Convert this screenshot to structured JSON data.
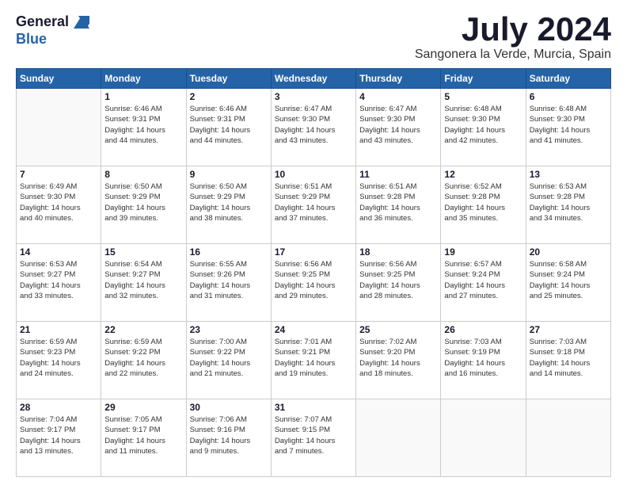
{
  "header": {
    "logo_line1": "General",
    "logo_line2": "Blue",
    "month": "July 2024",
    "location": "Sangonera la Verde, Murcia, Spain"
  },
  "days_of_week": [
    "Sunday",
    "Monday",
    "Tuesday",
    "Wednesday",
    "Thursday",
    "Friday",
    "Saturday"
  ],
  "weeks": [
    [
      {
        "day": "",
        "info": ""
      },
      {
        "day": "1",
        "info": "Sunrise: 6:46 AM\nSunset: 9:31 PM\nDaylight: 14 hours\nand 44 minutes."
      },
      {
        "day": "2",
        "info": "Sunrise: 6:46 AM\nSunset: 9:31 PM\nDaylight: 14 hours\nand 44 minutes."
      },
      {
        "day": "3",
        "info": "Sunrise: 6:47 AM\nSunset: 9:30 PM\nDaylight: 14 hours\nand 43 minutes."
      },
      {
        "day": "4",
        "info": "Sunrise: 6:47 AM\nSunset: 9:30 PM\nDaylight: 14 hours\nand 43 minutes."
      },
      {
        "day": "5",
        "info": "Sunrise: 6:48 AM\nSunset: 9:30 PM\nDaylight: 14 hours\nand 42 minutes."
      },
      {
        "day": "6",
        "info": "Sunrise: 6:48 AM\nSunset: 9:30 PM\nDaylight: 14 hours\nand 41 minutes."
      }
    ],
    [
      {
        "day": "7",
        "info": "Sunrise: 6:49 AM\nSunset: 9:30 PM\nDaylight: 14 hours\nand 40 minutes."
      },
      {
        "day": "8",
        "info": "Sunrise: 6:50 AM\nSunset: 9:29 PM\nDaylight: 14 hours\nand 39 minutes."
      },
      {
        "day": "9",
        "info": "Sunrise: 6:50 AM\nSunset: 9:29 PM\nDaylight: 14 hours\nand 38 minutes."
      },
      {
        "day": "10",
        "info": "Sunrise: 6:51 AM\nSunset: 9:29 PM\nDaylight: 14 hours\nand 37 minutes."
      },
      {
        "day": "11",
        "info": "Sunrise: 6:51 AM\nSunset: 9:28 PM\nDaylight: 14 hours\nand 36 minutes."
      },
      {
        "day": "12",
        "info": "Sunrise: 6:52 AM\nSunset: 9:28 PM\nDaylight: 14 hours\nand 35 minutes."
      },
      {
        "day": "13",
        "info": "Sunrise: 6:53 AM\nSunset: 9:28 PM\nDaylight: 14 hours\nand 34 minutes."
      }
    ],
    [
      {
        "day": "14",
        "info": "Sunrise: 6:53 AM\nSunset: 9:27 PM\nDaylight: 14 hours\nand 33 minutes."
      },
      {
        "day": "15",
        "info": "Sunrise: 6:54 AM\nSunset: 9:27 PM\nDaylight: 14 hours\nand 32 minutes."
      },
      {
        "day": "16",
        "info": "Sunrise: 6:55 AM\nSunset: 9:26 PM\nDaylight: 14 hours\nand 31 minutes."
      },
      {
        "day": "17",
        "info": "Sunrise: 6:56 AM\nSunset: 9:25 PM\nDaylight: 14 hours\nand 29 minutes."
      },
      {
        "day": "18",
        "info": "Sunrise: 6:56 AM\nSunset: 9:25 PM\nDaylight: 14 hours\nand 28 minutes."
      },
      {
        "day": "19",
        "info": "Sunrise: 6:57 AM\nSunset: 9:24 PM\nDaylight: 14 hours\nand 27 minutes."
      },
      {
        "day": "20",
        "info": "Sunrise: 6:58 AM\nSunset: 9:24 PM\nDaylight: 14 hours\nand 25 minutes."
      }
    ],
    [
      {
        "day": "21",
        "info": "Sunrise: 6:59 AM\nSunset: 9:23 PM\nDaylight: 14 hours\nand 24 minutes."
      },
      {
        "day": "22",
        "info": "Sunrise: 6:59 AM\nSunset: 9:22 PM\nDaylight: 14 hours\nand 22 minutes."
      },
      {
        "day": "23",
        "info": "Sunrise: 7:00 AM\nSunset: 9:22 PM\nDaylight: 14 hours\nand 21 minutes."
      },
      {
        "day": "24",
        "info": "Sunrise: 7:01 AM\nSunset: 9:21 PM\nDaylight: 14 hours\nand 19 minutes."
      },
      {
        "day": "25",
        "info": "Sunrise: 7:02 AM\nSunset: 9:20 PM\nDaylight: 14 hours\nand 18 minutes."
      },
      {
        "day": "26",
        "info": "Sunrise: 7:03 AM\nSunset: 9:19 PM\nDaylight: 14 hours\nand 16 minutes."
      },
      {
        "day": "27",
        "info": "Sunrise: 7:03 AM\nSunset: 9:18 PM\nDaylight: 14 hours\nand 14 minutes."
      }
    ],
    [
      {
        "day": "28",
        "info": "Sunrise: 7:04 AM\nSunset: 9:17 PM\nDaylight: 14 hours\nand 13 minutes."
      },
      {
        "day": "29",
        "info": "Sunrise: 7:05 AM\nSunset: 9:17 PM\nDaylight: 14 hours\nand 11 minutes."
      },
      {
        "day": "30",
        "info": "Sunrise: 7:06 AM\nSunset: 9:16 PM\nDaylight: 14 hours\nand 9 minutes."
      },
      {
        "day": "31",
        "info": "Sunrise: 7:07 AM\nSunset: 9:15 PM\nDaylight: 14 hours\nand 7 minutes."
      },
      {
        "day": "",
        "info": ""
      },
      {
        "day": "",
        "info": ""
      },
      {
        "day": "",
        "info": ""
      }
    ]
  ]
}
